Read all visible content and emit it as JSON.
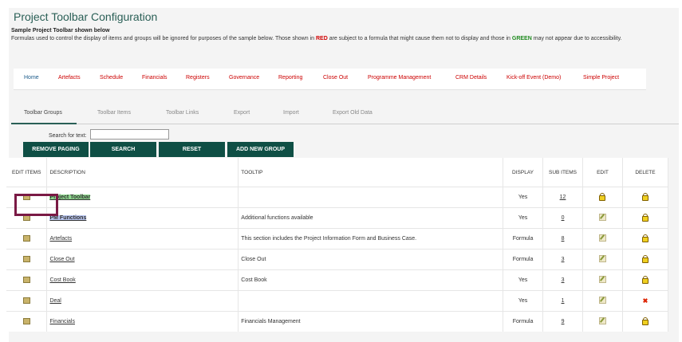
{
  "page": {
    "title": "Project Toolbar Configuration",
    "sample_title": "Sample Project Toolbar shown below",
    "notice_part1": "Formulas used to control the display of items and groups will be ignored for purposes of the sample below. Those shown in ",
    "notice_red": "RED",
    "notice_part2": " are subject to a formula that might cause them not to display and those in ",
    "notice_green": "GREEN",
    "notice_part3": " may not appear due to accessibility."
  },
  "menu": {
    "items": [
      "Home",
      "Artefacts",
      "Schedule",
      "Financials",
      "Registers",
      "Governance",
      "Reporting",
      "Close Out",
      "Programme Management",
      "CRM Details",
      "Kick-off Event (Demo)",
      "Simple Project"
    ]
  },
  "tabs": {
    "items": [
      "Toolbar Groups",
      "Toolbar Items",
      "Toolbar Links",
      "Export",
      "Import",
      "Export Old Data"
    ],
    "active": "Toolbar Groups"
  },
  "search": {
    "label": "Search for text:",
    "value": "",
    "buttons": {
      "remove_paging": "REMOVE PAGING",
      "search": "SEARCH",
      "reset": "RESET",
      "add_new_group": "ADD NEW GROUP"
    }
  },
  "table": {
    "headers": {
      "edit_items": "EDIT ITEMS",
      "description": "DESCRIPTION",
      "tooltip": "TOOLTIP",
      "display": "DISPLAY",
      "sub_items": "SUB ITEMS",
      "edit": "EDIT",
      "delete": "DELETE"
    },
    "rows": [
      {
        "description": "Project Toolbar",
        "tooltip": "",
        "display": "Yes",
        "sub_items": "12",
        "edit_icon": "lock-icon",
        "delete_icon": "lock-icon",
        "highlight": "green"
      },
      {
        "description": "PM Functions",
        "tooltip": "Additional functions available",
        "display": "Yes",
        "sub_items": "0",
        "edit_icon": "pencil-icon",
        "delete_icon": "lock-icon",
        "highlight": "blue"
      },
      {
        "description": "Artefacts",
        "tooltip": "This section includes the Project Information Form and Business Case.",
        "display": "Formula",
        "sub_items": "8",
        "edit_icon": "pencil-icon",
        "delete_icon": "lock-icon",
        "highlight": ""
      },
      {
        "description": "Close Out",
        "tooltip": "Close Out",
        "display": "Formula",
        "sub_items": "3",
        "edit_icon": "pencil-icon",
        "delete_icon": "lock-icon",
        "highlight": ""
      },
      {
        "description": "Cost Book",
        "tooltip": "Cost Book",
        "display": "Yes",
        "sub_items": "3",
        "edit_icon": "pencil-icon",
        "delete_icon": "lock-icon",
        "highlight": ""
      },
      {
        "description": "Deal",
        "tooltip": "",
        "display": "Yes",
        "sub_items": "1",
        "edit_icon": "pencil-icon",
        "delete_icon": "x-icon",
        "highlight": ""
      },
      {
        "description": "Financials",
        "tooltip": "Financials Management",
        "display": "Formula",
        "sub_items": "9",
        "edit_icon": "pencil-icon",
        "delete_icon": "lock-icon",
        "highlight": ""
      }
    ]
  },
  "colors": {
    "title": "#2a5f56",
    "button_bg": "#0f4f45",
    "menu_link": "#cc0000",
    "home_link": "#1a5a8a",
    "highlight_green": "#8fd98f",
    "highlight_blue": "#b9c6f0",
    "callout_box": "#7a1a45"
  }
}
